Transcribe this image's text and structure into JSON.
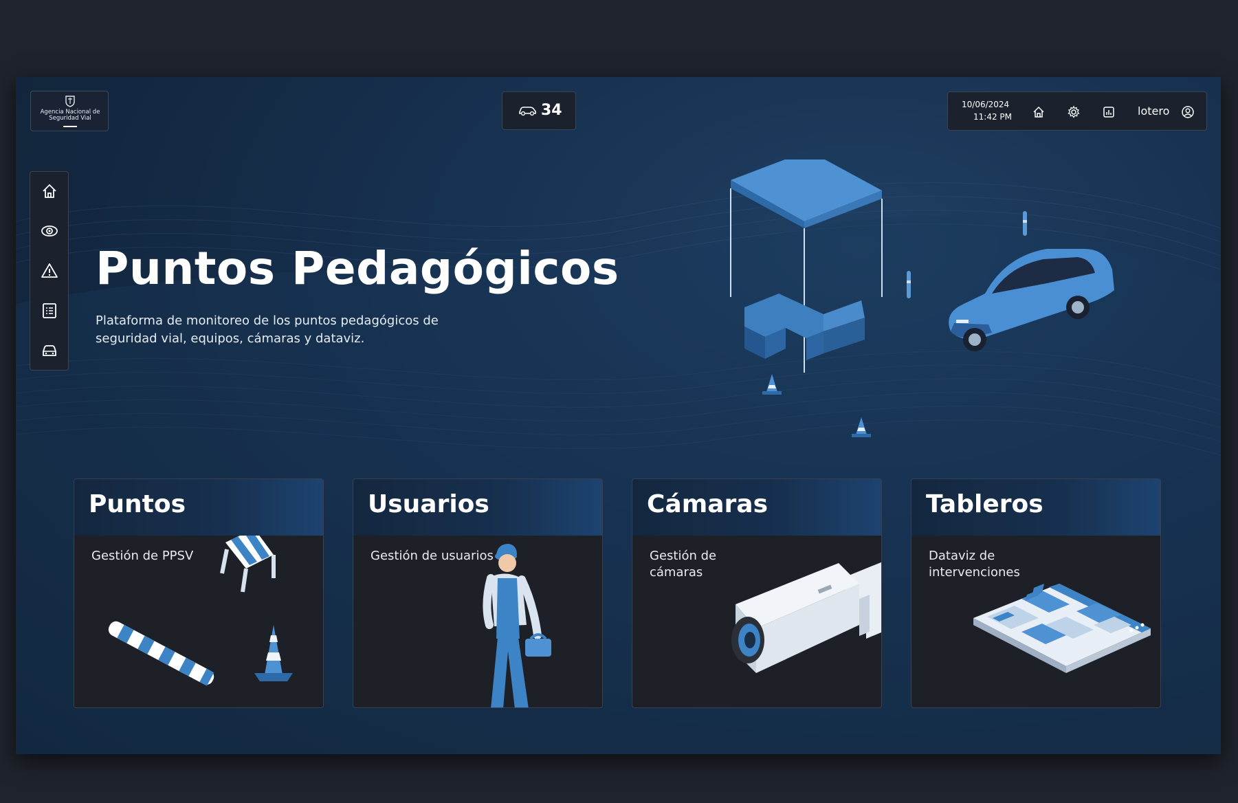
{
  "app": {
    "logo_text": "Agencia Nacional de Seguridad Vial"
  },
  "counter": {
    "icon": "car-icon",
    "value": "34"
  },
  "topbar": {
    "date": "10/06/2024",
    "time": "11:42 PM",
    "icons": [
      "home-icon",
      "gear-icon",
      "chart-icon"
    ],
    "user": "lotero",
    "user_icon": "user-circle-icon"
  },
  "sidenav": {
    "items": [
      "home-icon",
      "eye-icon",
      "warning-icon",
      "list-icon",
      "car-icon"
    ]
  },
  "hero": {
    "title": "Puntos Pedagógicos",
    "description": "Plataforma de monitoreo de los puntos pedagógicos de seguridad vial, equipos, cámaras y dataviz."
  },
  "cards": [
    {
      "title": "Puntos",
      "subtitle": "Gestión de PPSV"
    },
    {
      "title": "Usuarios",
      "subtitle": "Gestión de usuarios"
    },
    {
      "title": "Cámaras",
      "subtitle": "Gestión de cámaras"
    },
    {
      "title": "Tableros",
      "subtitle": "Dataviz de intervenciones"
    }
  ],
  "colors": {
    "accent": "#3d84c6",
    "background": "#12263d",
    "panel": "#1b222d"
  }
}
